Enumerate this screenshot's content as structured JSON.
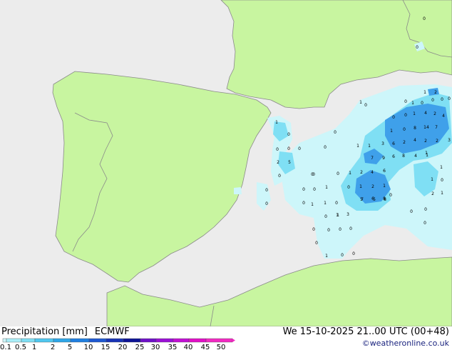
{
  "title": {
    "product": "Precipitation [mm]",
    "model": "ECMWF",
    "valid_time": "We 15-10-2025 21..00 UTC (00+48)",
    "credit": "©weatheronline.co.uk"
  },
  "legend": {
    "ticks": [
      "0.1",
      "0.5",
      "1",
      "2",
      "5",
      "10",
      "15",
      "20",
      "25",
      "30",
      "35",
      "40",
      "45",
      "50"
    ],
    "colors": [
      "#cdf6fa",
      "#a9eef8",
      "#7fdff4",
      "#4fc7ef",
      "#2ea6e8",
      "#1f7fe0",
      "#1d58d2",
      "#1733b6",
      "#0d1396",
      "#6e10c8",
      "#9a0fd6",
      "#c20fd4",
      "#e10fc6",
      "#f22ac2"
    ]
  },
  "colors": {
    "land": "#c8f5a0",
    "sea": "#ececec",
    "border": "#8a8a8a",
    "precip_light": "#cdf6fa",
    "precip_mid": "#7fdff4",
    "precip_heavy": "#3fa0ea"
  },
  "labels": [
    {
      "t": "0"
    },
    {
      "t": "0"
    },
    {
      "t": "0"
    },
    {
      "t": "1"
    },
    {
      "t": "0"
    },
    {
      "t": "0"
    },
    {
      "t": "0"
    },
    {
      "t": "0"
    },
    {
      "t": "0"
    },
    {
      "t": "2"
    },
    {
      "t": "5"
    },
    {
      "t": "0"
    },
    {
      "t": "0"
    },
    {
      "t": "0"
    },
    {
      "t": "0"
    },
    {
      "t": "0"
    },
    {
      "t": "0"
    },
    {
      "t": "0"
    },
    {
      "t": "0"
    },
    {
      "t": "1"
    },
    {
      "t": "1"
    },
    {
      "t": "1"
    },
    {
      "t": "3"
    },
    {
      "t": "6"
    },
    {
      "t": "2"
    },
    {
      "t": "4"
    },
    {
      "t": "1"
    },
    {
      "t": "6"
    },
    {
      "t": "9"
    },
    {
      "t": "7"
    },
    {
      "t": "8"
    },
    {
      "t": "4"
    },
    {
      "t": "1"
    },
    {
      "t": "0"
    },
    {
      "t": "1"
    },
    {
      "t": "2"
    },
    {
      "t": "4"
    },
    {
      "t": "6"
    },
    {
      "t": "0"
    },
    {
      "t": "1"
    },
    {
      "t": "2"
    },
    {
      "t": "1"
    },
    {
      "t": "5"
    },
    {
      "t": "6"
    },
    {
      "t": "8"
    },
    {
      "t": "0"
    },
    {
      "t": "1"
    },
    {
      "t": "3"
    },
    {
      "t": "7"
    },
    {
      "t": "5"
    },
    {
      "t": "8"
    },
    {
      "t": "0"
    },
    {
      "t": "0"
    },
    {
      "t": "0"
    },
    {
      "t": "1"
    },
    {
      "t": "0"
    },
    {
      "t": "0"
    },
    {
      "t": "0"
    },
    {
      "t": "0"
    },
    {
      "t": "0"
    },
    {
      "t": "1"
    },
    {
      "t": "0"
    },
    {
      "t": "0"
    },
    {
      "t": "0"
    },
    {
      "t": "0"
    },
    {
      "t": "1"
    },
    {
      "t": "0"
    },
    {
      "t": "2"
    },
    {
      "t": "1"
    },
    {
      "t": "1"
    },
    {
      "t": "0"
    },
    {
      "t": "0"
    },
    {
      "t": "0"
    },
    {
      "t": "0"
    },
    {
      "t": "0"
    },
    {
      "t": "1"
    },
    {
      "t": "4"
    },
    {
      "t": "2"
    },
    {
      "t": "1"
    },
    {
      "t": "0"
    },
    {
      "t": "8"
    },
    {
      "t": "14"
    },
    {
      "t": "7"
    },
    {
      "t": "4"
    },
    {
      "t": "2"
    },
    {
      "t": "2"
    },
    {
      "t": "3"
    },
    {
      "t": "0"
    },
    {
      "t": "1"
    },
    {
      "t": "0"
    },
    {
      "t": "1"
    },
    {
      "t": "1"
    },
    {
      "t": "1"
    },
    {
      "t": "0"
    },
    {
      "t": "1"
    },
    {
      "t": "2"
    }
  ]
}
